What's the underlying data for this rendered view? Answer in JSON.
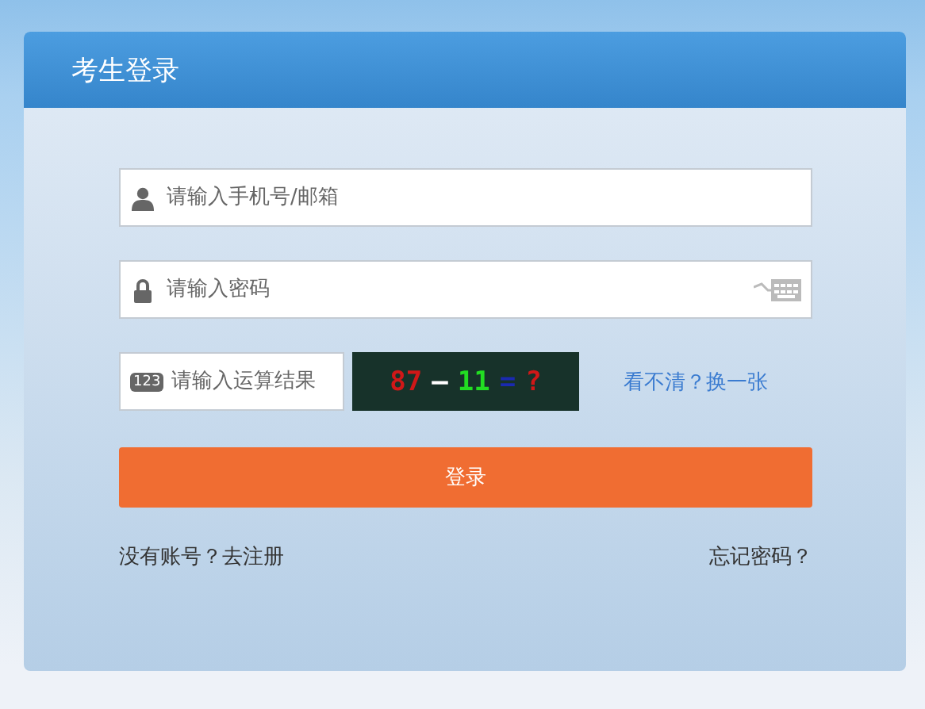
{
  "panel": {
    "title": "考生登录"
  },
  "fields": [
    {
      "kind": "user",
      "placeholder": "请输入手机号/邮箱"
    },
    {
      "kind": "password",
      "placeholder": "请输入密码"
    }
  ],
  "captcha": {
    "placeholder": "请输入运算结果",
    "icon_text": "123",
    "parts": [
      {
        "text": "87",
        "color": "#d01818"
      },
      {
        "text": "—",
        "color": "#ffffff"
      },
      {
        "text": "11",
        "color": "#22dd22"
      },
      {
        "text": "=",
        "color": "#1a2ab0"
      },
      {
        "text": "?",
        "color": "#d01818"
      }
    ],
    "refresh": "看不清？换一张"
  },
  "login_button": "登录",
  "register_link": "没有账号？去注册",
  "forgot_link": "忘记密码？"
}
